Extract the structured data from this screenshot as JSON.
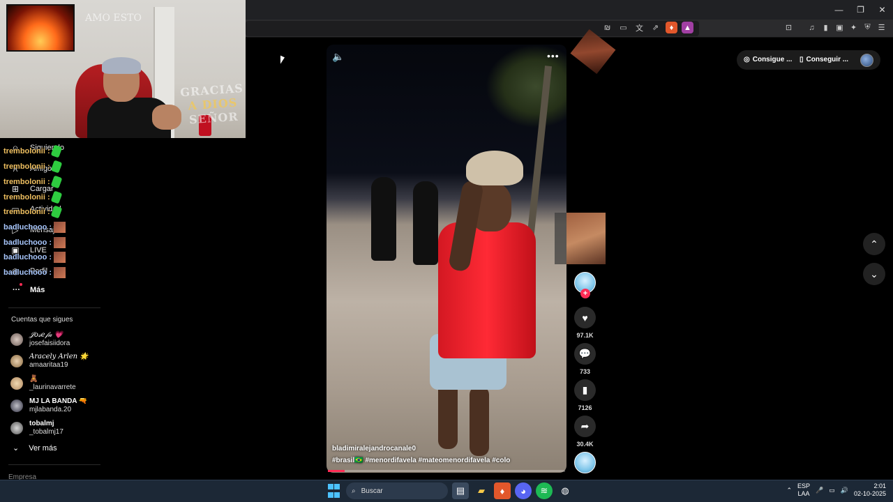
{
  "browser": {
    "window_controls": [
      "—",
      "❐",
      "✕"
    ]
  },
  "chat": [
    {
      "user": "trembolonii :",
      "emote": "green"
    },
    {
      "user": "trembolonii :",
      "emote": "green"
    },
    {
      "user": "trembolonii :",
      "emote": "green"
    },
    {
      "user": "trembolonii :",
      "emote": "green"
    },
    {
      "user": "trembolonii :",
      "emote": "green"
    },
    {
      "user": "badluchooo :",
      "emote": "face"
    },
    {
      "user": "badluchooo :",
      "emote": "face"
    },
    {
      "user": "badluchooo :",
      "emote": "face"
    },
    {
      "user": "badluchooo :",
      "emote": "face"
    }
  ],
  "webcam": {
    "wall_text_1": "GRACIAS",
    "wall_text_2": "A DIOS",
    "wall_text_3": "SEÑOR",
    "scribble": "AMO ESTO"
  },
  "sidebar": {
    "nav": [
      {
        "label": "Siguiendo",
        "icon": "person-icon"
      },
      {
        "label": "Amigos",
        "icon": "friends-icon"
      },
      {
        "label": "Cargar",
        "icon": "upload-icon"
      },
      {
        "label": "Actividad",
        "icon": "activity-icon"
      },
      {
        "label": "Mensajes",
        "icon": "message-icon"
      },
      {
        "label": "LIVE",
        "icon": "live-icon"
      },
      {
        "label": "Perfil",
        "icon": "profile-icon"
      }
    ],
    "more": "Más",
    "section_title": "Cuentas que sigues",
    "following": [
      {
        "name": "𝒥𝑜𝓈𝑒𝒻𝒶 💗",
        "handle": "josefaisiidora",
        "script": true
      },
      {
        "name": "𝐴𝑟𝑎𝑐𝑒𝑙𝑦 𝐴𝑟𝑙𝑒𝑛 🌟",
        "handle": "amaaritaa19",
        "script": true
      },
      {
        "name": "🧸",
        "handle": "_laurinavarrete",
        "script": false
      },
      {
        "name": "MJ LA BANDA 🔫",
        "handle": "mjlabanda.20",
        "script": false
      },
      {
        "name": "tobalmj",
        "handle": "_tobalmj17",
        "script": false
      }
    ],
    "see_more": "Ver más",
    "company": "Empresa"
  },
  "video": {
    "author": "bladimiralejandrocanale0",
    "tags": "#brasil🇧🇷  #menordifavela  #mateomenordifavela  #colo",
    "progress": 0.07
  },
  "actions": {
    "likes": "97.1K",
    "comments": "733",
    "saves": "7126",
    "shares": "30.4K"
  },
  "top_right": {
    "get_app": "Consigue ...",
    "get_desktop": "Conseguir ..."
  },
  "taskbar": {
    "search": "Buscar",
    "lang_1": "ESP",
    "lang_2": "LAA",
    "time": "2:01",
    "date": "02-10-2025"
  },
  "colors": {
    "accent": "#fe2c55",
    "taskbar": "#1c2836"
  }
}
